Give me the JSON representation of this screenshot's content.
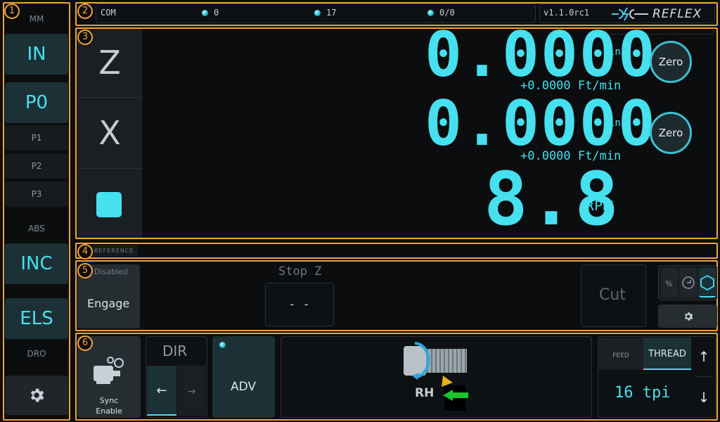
{
  "callouts": [
    "1",
    "2",
    "3",
    "4",
    "5",
    "6"
  ],
  "left": {
    "units_label": "MM",
    "units_btn": "IN",
    "p0": "P0",
    "p1": "P1",
    "p2": "P2",
    "p3": "P3",
    "abs_label": "ABS",
    "inc_btn": "INC",
    "els_btn": "ELS",
    "dro_label": "DRO"
  },
  "header": {
    "com": "COM",
    "stat1": "0",
    "stat2": "17",
    "stat3": "0/0",
    "version": "v1.1.0rc1",
    "brand": "REFLEX"
  },
  "dro": {
    "z_label": "Z",
    "x_label": "X",
    "z_value": "0.0000",
    "x_value": "0.0000",
    "z_unit": "in",
    "x_unit": "in",
    "z_feed": "+0.0000 Ft/min",
    "x_feed": "+0.0000 Ft/min",
    "zero": "Zero",
    "rpm_value": "8.8",
    "rpm_unit": "RPM"
  },
  "reference": {
    "label": "REFERENCE"
  },
  "control": {
    "status": "Disabled",
    "engage": "Engage",
    "stop_label": "Stop Z",
    "stop_value": "- -",
    "cut": "Cut"
  },
  "bottom": {
    "sync": "Sync\nEnable",
    "dir": "DIR",
    "dir_left": "←",
    "dir_right": "→",
    "adv": "ADV",
    "rh": "RH",
    "feed_tab": "FEED",
    "thread_tab": "THREAD",
    "pitch": "16 tpi",
    "up": "↑",
    "down": "↓"
  },
  "colors": {
    "accent": "#46e0ef",
    "frame": "#f0a43a",
    "panel": "#1a1f22"
  }
}
